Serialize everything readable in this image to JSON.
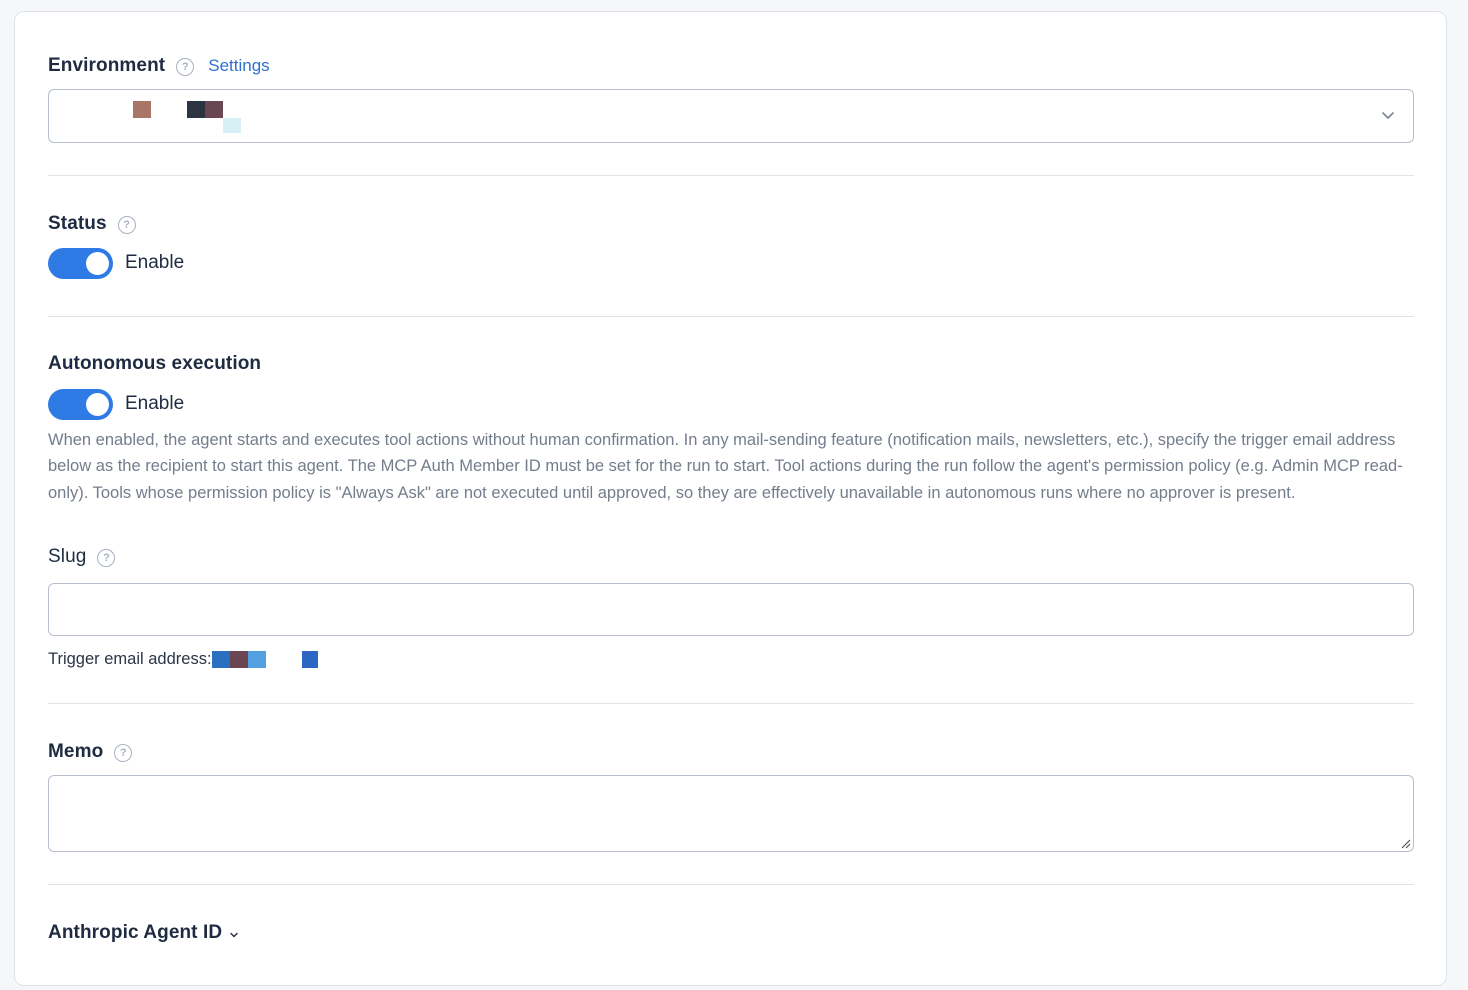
{
  "environment": {
    "label": "Environment",
    "settings_link": "Settings"
  },
  "status": {
    "label": "Status",
    "toggle_label": "Enable",
    "enabled": true
  },
  "autonomous": {
    "label": "Autonomous execution",
    "toggle_label": "Enable",
    "enabled": true,
    "description": "When enabled, the agent starts and executes tool actions without human confirmation. In any mail-sending feature (notification mails, newsletters, etc.), specify the trigger email address below as the recipient to start this agent. The MCP Auth Member ID must be set for the run to start. Tool actions during the run follow the agent's permission policy (e.g. Admin MCP read-only). Tools whose permission policy is \"Always Ask\" are not executed until approved, so they are effectively unavailable in autonomous runs where no approver is present."
  },
  "slug": {
    "label": "Slug",
    "value": "",
    "trigger_label": "Trigger email address:"
  },
  "memo": {
    "label": "Memo",
    "value": ""
  },
  "anthropic": {
    "label": "Anthropic Agent ID"
  },
  "colors": {
    "accent": "#2f7be6",
    "link": "#2f6fd0",
    "border": "#b7bfcc"
  },
  "icons": {
    "help": "question-circle-icon",
    "dropdown": "chevron-down-icon"
  }
}
